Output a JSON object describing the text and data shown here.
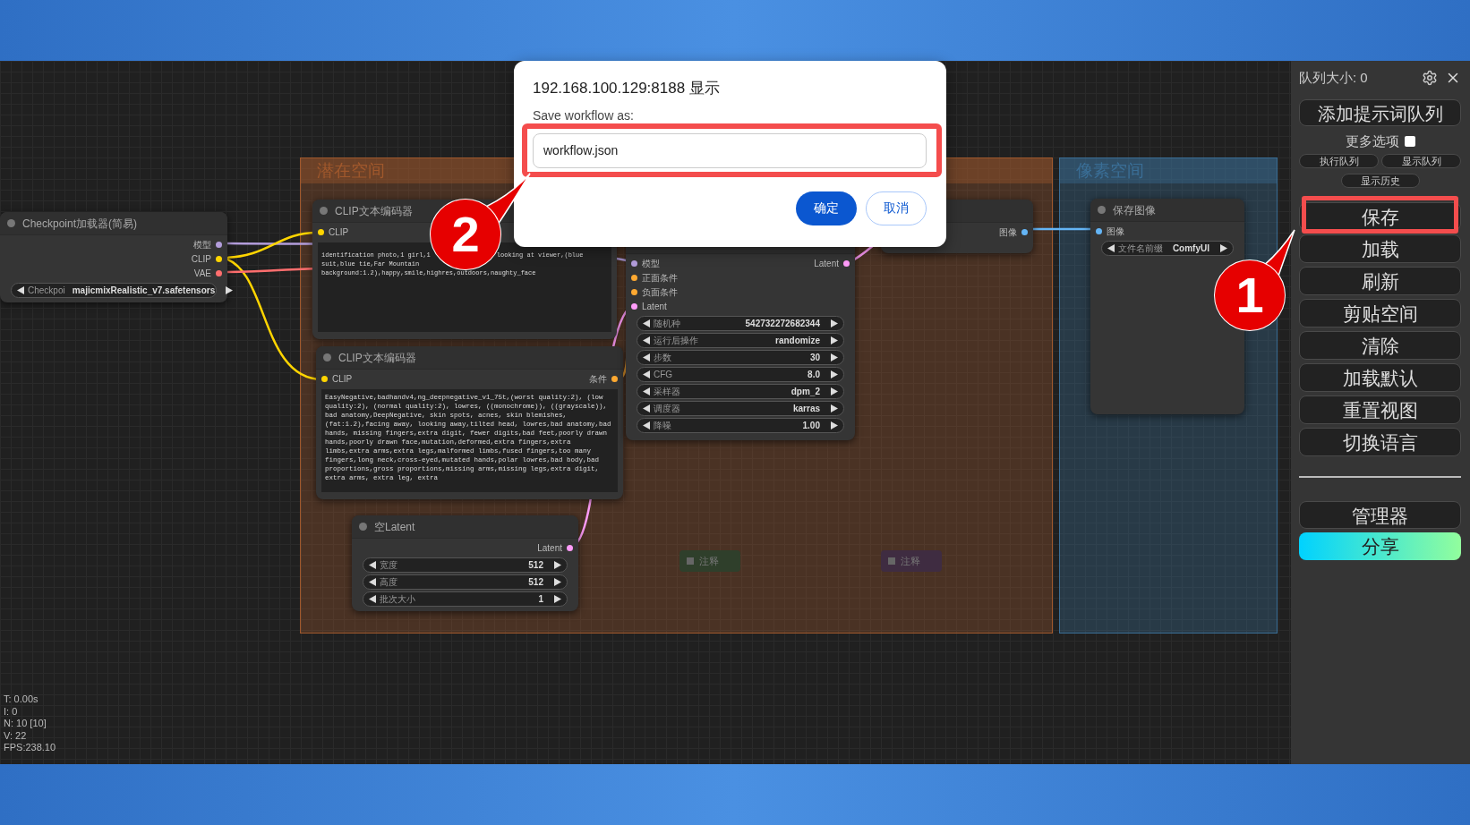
{
  "groups": [
    {
      "title": "潜在空间",
      "color": "#a0582c"
    },
    {
      "title": "像素空间",
      "color": "#3a6e96"
    }
  ],
  "nodes": [
    {
      "title": "Checkpoint加载器(简易)",
      "outputs": [
        {
          "label": "模型",
          "color": "#b39ddb"
        },
        {
          "label": "CLIP",
          "color": "#ffd500"
        },
        {
          "label": "VAE",
          "color": "#ff6e6e"
        }
      ],
      "widgets": [
        {
          "label": "Checkpoi",
          "value": "majicmixRealistic_v7.safetensors"
        }
      ]
    },
    {
      "title": "CLIP文本编码器",
      "inputs": [
        {
          "label": "CLIP",
          "color": "#ffd500"
        }
      ],
      "text_lines": [
        [
          "identification photo,1 girl,1",
          "looking at viewer,(blue"
        ],
        [
          "suit,blue tie,Far Mountain"
        ],
        [
          "background:1.2),happy,smile,highres,outdoors,naughty_face"
        ]
      ]
    },
    {
      "title": "CLIP文本编码器",
      "inputs": [
        {
          "label": "CLIP",
          "color": "#ffd500"
        }
      ],
      "outputs": [
        {
          "label": "条件",
          "color": "#ffa931"
        }
      ],
      "text": "EasyNegative,badhandv4,ng_deepnegative_v1_75t,(worst quality:2), (low quality:2), (normal quality:2), lowres, ((monochrome)), ((grayscale)), bad anatomy,DeepNegative, skin spots, acnes, skin blemishes,(fat:1.2),facing away, looking away,tilted head, lowres,bad anatomy,bad hands, missing fingers,extra digit, fewer digits,bad feet,poorly drawn hands,poorly drawn face,mutation,deformed,extra fingers,extra limbs,extra arms,extra legs,malformed limbs,fused fingers,too many fingers,long neck,cross-eyed,mutated hands,polar lowres,bad body,bad proportions,gross proportions,missing arms,missing legs,extra digit, extra arms, extra leg, extra"
    },
    {
      "inputs": [
        {
          "label": "模型",
          "color": "#b39ddb"
        },
        {
          "label": "正面条件",
          "color": "#ffa931"
        },
        {
          "label": "负面条件",
          "color": "#ffa931"
        },
        {
          "label": "Latent",
          "color": "#ff9cf9"
        }
      ],
      "outputs": [
        {
          "label": "Latent",
          "color": "#ff9cf9"
        }
      ],
      "widgets": [
        {
          "label": "随机种",
          "value": "542732272682344"
        },
        {
          "label": "运行后操作",
          "value": "randomize"
        },
        {
          "label": "步数",
          "value": "30"
        },
        {
          "label": "CFG",
          "value": "8.0"
        },
        {
          "label": "采样器",
          "value": "dpm_2"
        },
        {
          "label": "调度器",
          "value": "karras"
        },
        {
          "label": "降噪",
          "value": "1.00"
        }
      ]
    },
    {
      "outputs": [
        {
          "label": "图像",
          "color": "#64b5f6"
        }
      ]
    },
    {
      "title": "保存图像",
      "inputs": [
        {
          "label": "图像",
          "color": "#64b5f6"
        }
      ],
      "widgets": [
        {
          "label": "文件名前缀",
          "value": "ComfyUI"
        }
      ]
    },
    {
      "title": "空Latent",
      "outputs": [
        {
          "label": "Latent",
          "color": "#ff9cf9"
        }
      ],
      "widgets": [
        {
          "label": "宽度",
          "value": "512"
        },
        {
          "label": "高度",
          "value": "512"
        },
        {
          "label": "批次大小",
          "value": "1"
        }
      ]
    }
  ],
  "notes": [
    {
      "label": "注释",
      "color": "#2f3f2b"
    },
    {
      "label": "注释",
      "color": "#3f2c41"
    }
  ],
  "stats": [
    "T: 0.00s",
    "I: 0",
    "N: 10 [10]",
    "V: 22",
    "FPS:238.10"
  ],
  "sidebar": {
    "queue_size": "队列大小: 0",
    "queue_button": "添加提示词队列",
    "more_options": {
      "label": "更多选项",
      "checked": false
    },
    "small_buttons": [
      "执行队列",
      "显示队列",
      "显示历史"
    ],
    "buttons": [
      {
        "label": "保存",
        "highlighted": true
      },
      {
        "label": "加载",
        "highlighted": false
      },
      {
        "label": "刷新",
        "highlighted": false
      },
      {
        "label": "剪贴空间",
        "highlighted": false
      },
      {
        "label": "清除",
        "highlighted": false
      },
      {
        "label": "加载默认",
        "highlighted": false
      },
      {
        "label": "重置视图",
        "highlighted": false
      },
      {
        "label": "切换语言",
        "highlighted": false
      }
    ],
    "extra_buttons": [
      {
        "label": "管理器",
        "kind": "plain"
      },
      {
        "label": "分享",
        "kind": "gradient"
      }
    ]
  },
  "dialog": {
    "title": "192.168.100.129:8188 显示",
    "label": "Save workflow as:",
    "value": "workflow.json",
    "highlighted": true,
    "buttons": [
      {
        "label": "确定",
        "kind": "primary"
      },
      {
        "label": "取消",
        "kind": "secondary"
      }
    ]
  },
  "callouts": [
    {
      "label": "2"
    },
    {
      "label": "1"
    }
  ]
}
